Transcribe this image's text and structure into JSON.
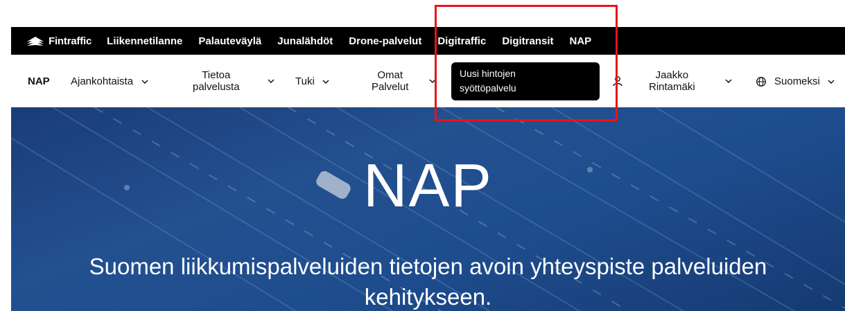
{
  "topbar": {
    "brand": "Fintraffic",
    "links": [
      "Liikennetilanne",
      "Palauteväylä",
      "Junalähdöt",
      "Drone-palvelut",
      "Digitraffic",
      "Digitransit",
      "NAP"
    ]
  },
  "navbar": {
    "home": "NAP",
    "ajankohtaista": "Ajankohtaista",
    "tietoa_line1": "Tietoa",
    "tietoa_line2": "palvelusta",
    "tuki": "Tuki",
    "omat_line1": "Omat",
    "omat_line2": "Palvelut",
    "user_line1": "Jaakko",
    "user_line2": "Rintamäki",
    "language": "Suomeksi"
  },
  "tooltip": {
    "line1": "Uusi hintojen",
    "line2": "syöttöpalvelu"
  },
  "hero": {
    "title": "NAP",
    "subtitle_line1": "Suomen liikkumispalveluiden tietojen avoin yhteyspiste palveluiden",
    "subtitle_line2": "kehitykseen."
  },
  "colors": {
    "highlight": "#e8131b",
    "topbar": "#000000",
    "hero": "#1e4d8e"
  }
}
